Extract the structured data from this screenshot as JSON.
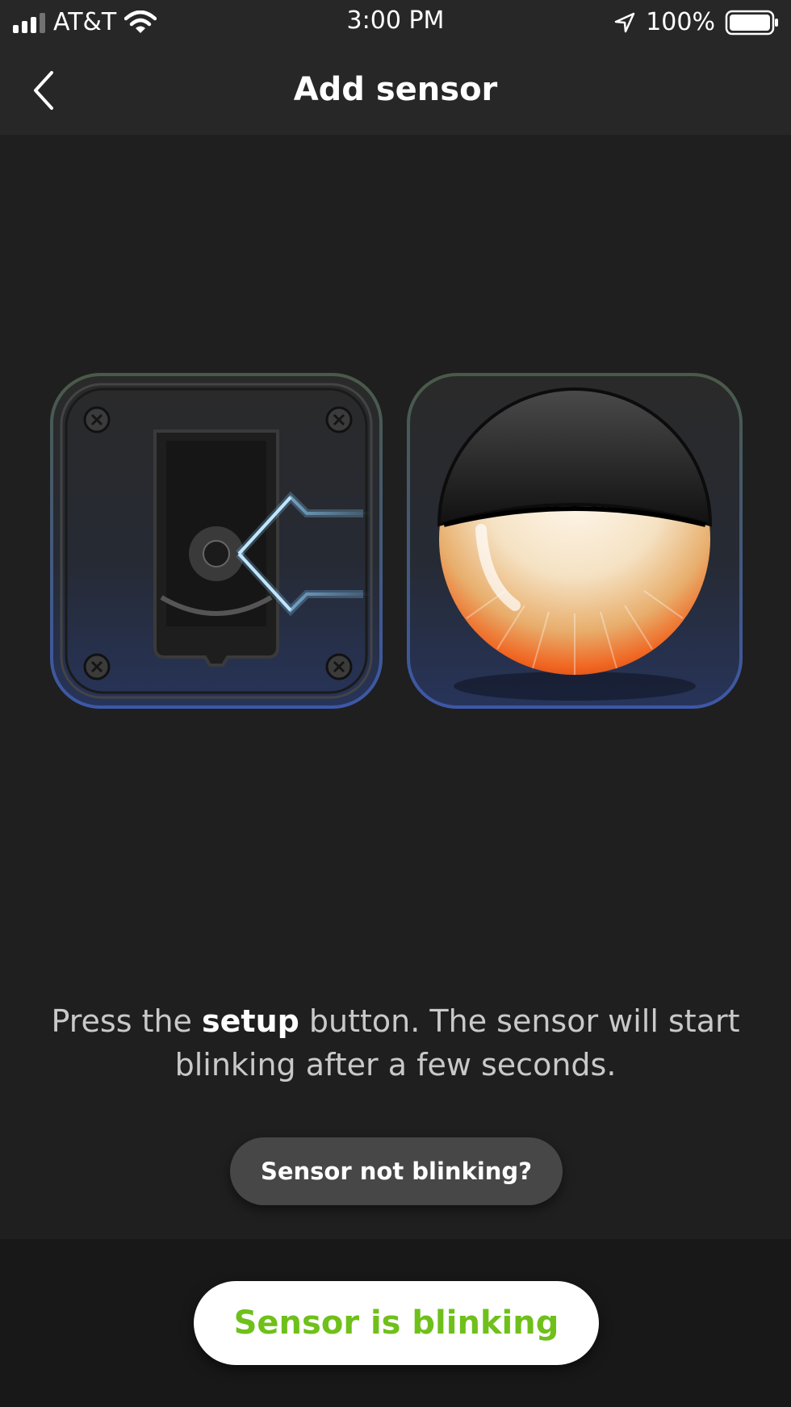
{
  "status_bar": {
    "carrier": "AT&T",
    "time": "3:00 PM",
    "battery": "100%",
    "icons": [
      "signal-icon",
      "wifi-icon",
      "location-arrow-icon",
      "battery-icon"
    ]
  },
  "header": {
    "title": "Add sensor",
    "back_icon": "chevron-left-icon"
  },
  "illustration": {
    "items": [
      "sensor-mount-icon",
      "motion-sensor-icon"
    ]
  },
  "instruction": {
    "prefix": "Press the ",
    "bold": "setup",
    "suffix": " button. The sensor will start blinking after a few seconds."
  },
  "buttons": {
    "not_blinking": "Sensor not blinking?",
    "blinking": "Sensor is blinking"
  },
  "colors": {
    "background": "#1f1f1f",
    "header_bg": "#272727",
    "accent_green": "#6fc01a",
    "secondary_btn": "#474747"
  }
}
